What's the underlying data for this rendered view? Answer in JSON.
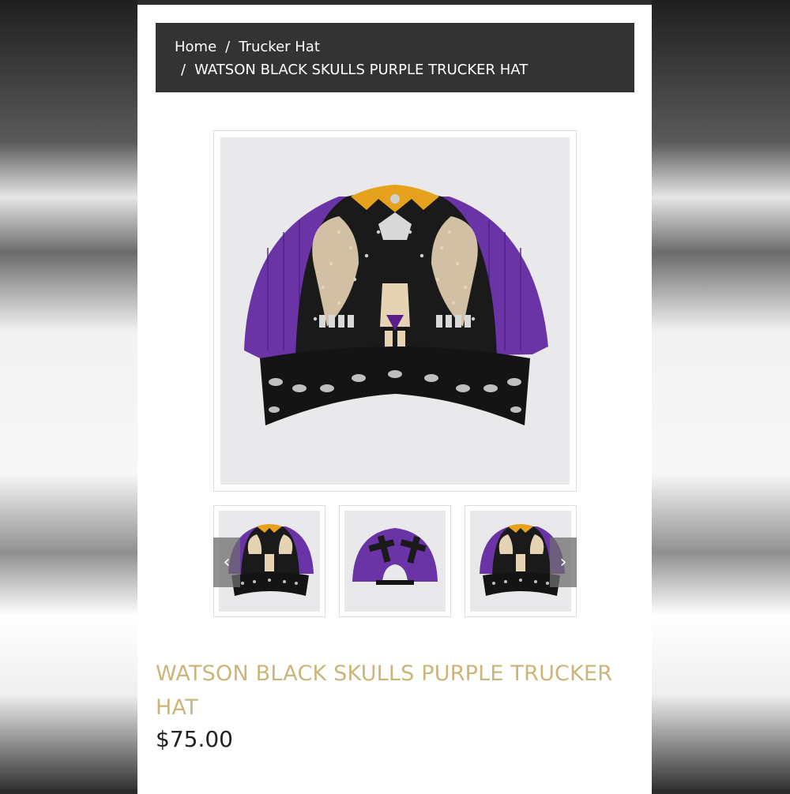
{
  "breadcrumb": {
    "home": "Home",
    "separator": "/",
    "category": "Trucker Hat",
    "current": "WATSON BLACK SKULLS PURPLE TRUCKER HAT"
  },
  "product": {
    "title": "WATSON BLACK SKULLS PURPLE TRUCKER HAT",
    "price": "$75.00"
  },
  "gallery": {
    "prev_arrow": "‹",
    "next_arrow": "›",
    "thumbnails": [
      "front-view",
      "back-view",
      "front-view"
    ]
  },
  "colors": {
    "hat_purple": "#6a33a6",
    "hat_black": "#141414",
    "accent_gold": "#cbb57b",
    "breadcrumb_bg": "#333333"
  }
}
